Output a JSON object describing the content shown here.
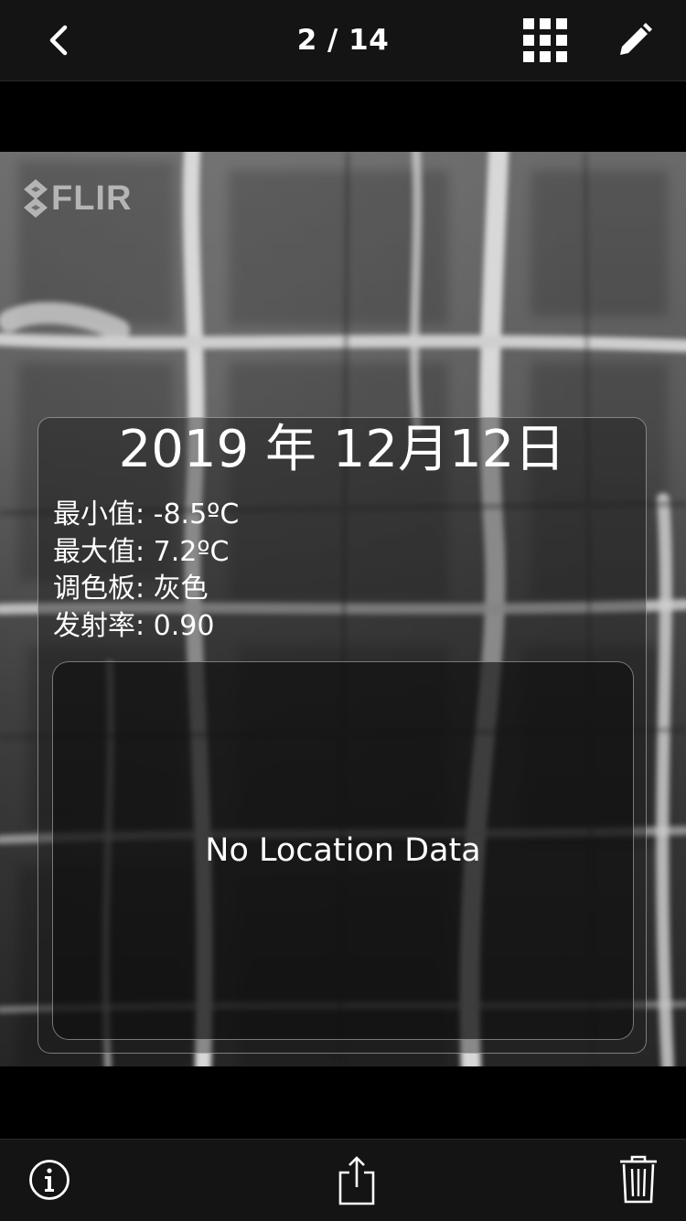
{
  "header": {
    "counter": "2 / 14",
    "icons": {
      "back": "chevron-left-icon",
      "grid": "grid-icon",
      "edit": "pencil-icon"
    }
  },
  "image": {
    "logo_text": "FLIR",
    "palette_colors": [
      "#262626",
      "#5a5a5a",
      "#d8d8d8"
    ]
  },
  "info": {
    "date": "2019 年 12月12日",
    "rows": [
      "最小值: -8.5ºC",
      "最大值: 7.2ºC",
      "调色板: 灰色",
      "发射率: 0.90"
    ],
    "location_text": "No Location Data"
  },
  "footer": {
    "icons": {
      "info": "info-icon",
      "share": "share-icon",
      "delete": "trash-icon"
    }
  }
}
